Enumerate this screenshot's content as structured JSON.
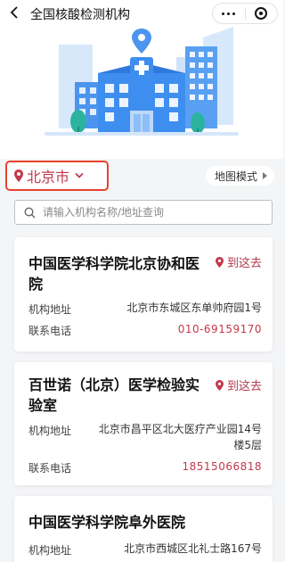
{
  "nav": {
    "title": "全国核酸检测机构"
  },
  "filter": {
    "city": "北京市",
    "map_mode": "地图模式"
  },
  "search": {
    "placeholder": "请输入机构名称/地址查询"
  },
  "labels": {
    "address": "机构地址",
    "phone": "联系电话",
    "go": "到这去"
  },
  "institutions": [
    {
      "name": "中国医学科学院北京协和医院",
      "address": "北京市东城区东单帅府园1号",
      "phone": "010-69159170"
    },
    {
      "name": "百世诺（北京）医学检验实验室",
      "address": "北京市昌平区北大医疗产业园14号楼5层",
      "phone": "18515066818"
    },
    {
      "name": "中国医学科学院阜外医院",
      "address": "北京市西城区北礼士路167号",
      "phone": ""
    }
  ],
  "colors": {
    "accent": "#c2384b",
    "highlight_border": "#e8432e",
    "hero_blue": "#3e8ef0"
  },
  "icons": [
    "back-arrow-icon",
    "more-dots-icon",
    "close-target-icon",
    "location-pin-icon",
    "chevron-down-icon",
    "play-triangle-icon",
    "search-icon",
    "hospital-illustration"
  ]
}
